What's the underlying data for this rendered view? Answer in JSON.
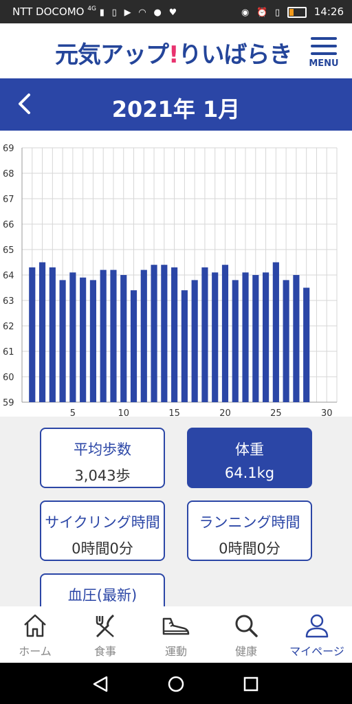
{
  "status_bar": {
    "carrier": "NTT DOCOMO",
    "network": "4G",
    "time": "14:26",
    "icons": [
      "signal-icon",
      "sim-icon",
      "youtube-icon",
      "wifi-icon",
      "line-icon",
      "heart-icon",
      "eye-icon",
      "alarm-icon",
      "vibrate-icon",
      "battery-icon"
    ],
    "battery_level": 0.25
  },
  "header": {
    "logo_main": "元気アップ",
    "logo_mark": "!",
    "logo_sub": "りいばらき",
    "menu_label": "MENU"
  },
  "month_nav": {
    "back_icon": "chevron-left-icon",
    "title": "2021年 1月"
  },
  "chart_data": {
    "type": "bar",
    "x": [
      1,
      2,
      3,
      4,
      5,
      6,
      7,
      8,
      9,
      10,
      11,
      12,
      13,
      14,
      15,
      16,
      17,
      18,
      19,
      20,
      21,
      22,
      23,
      24,
      25,
      26,
      27,
      28
    ],
    "values": [
      64.3,
      64.5,
      64.3,
      63.8,
      64.1,
      63.9,
      63.8,
      64.2,
      64.2,
      64.0,
      63.4,
      64.2,
      64.4,
      64.4,
      64.3,
      63.4,
      63.8,
      64.3,
      64.1,
      64.4,
      63.8,
      64.1,
      64.0,
      64.1,
      64.5,
      63.8,
      64.0,
      63.5
    ],
    "ylim": [
      59,
      69
    ],
    "y_ticks": [
      "59",
      "60",
      "61",
      "62",
      "63",
      "64",
      "65",
      "66",
      "67",
      "68",
      "69"
    ],
    "xlim": [
      0,
      31
    ],
    "x_ticks": [
      "5",
      "10",
      "15",
      "20",
      "25",
      "30"
    ],
    "grid": true,
    "bar_color": "#2b46a6"
  },
  "cards": [
    {
      "title": "平均歩数",
      "value": "3,043歩",
      "active": false
    },
    {
      "title": "体重",
      "value": "64.1kg",
      "active": true
    },
    {
      "title": "サイクリング時間",
      "value": "0時間0分",
      "active": false
    },
    {
      "title": "ランニング時間",
      "value": "0時間0分",
      "active": false
    },
    {
      "title": "血圧(最新)",
      "value": "",
      "active": false
    }
  ],
  "tabs": [
    {
      "label": "ホーム",
      "icon": "home-icon"
    },
    {
      "label": "食事",
      "icon": "fork-knife-icon"
    },
    {
      "label": "運動",
      "icon": "sneaker-icon"
    },
    {
      "label": "健康",
      "icon": "magnifier-icon"
    },
    {
      "label": "マイページ",
      "icon": "person-icon",
      "active": true
    }
  ],
  "nav_buttons": [
    "back-triangle-icon",
    "home-circle-icon",
    "recents-square-icon"
  ]
}
